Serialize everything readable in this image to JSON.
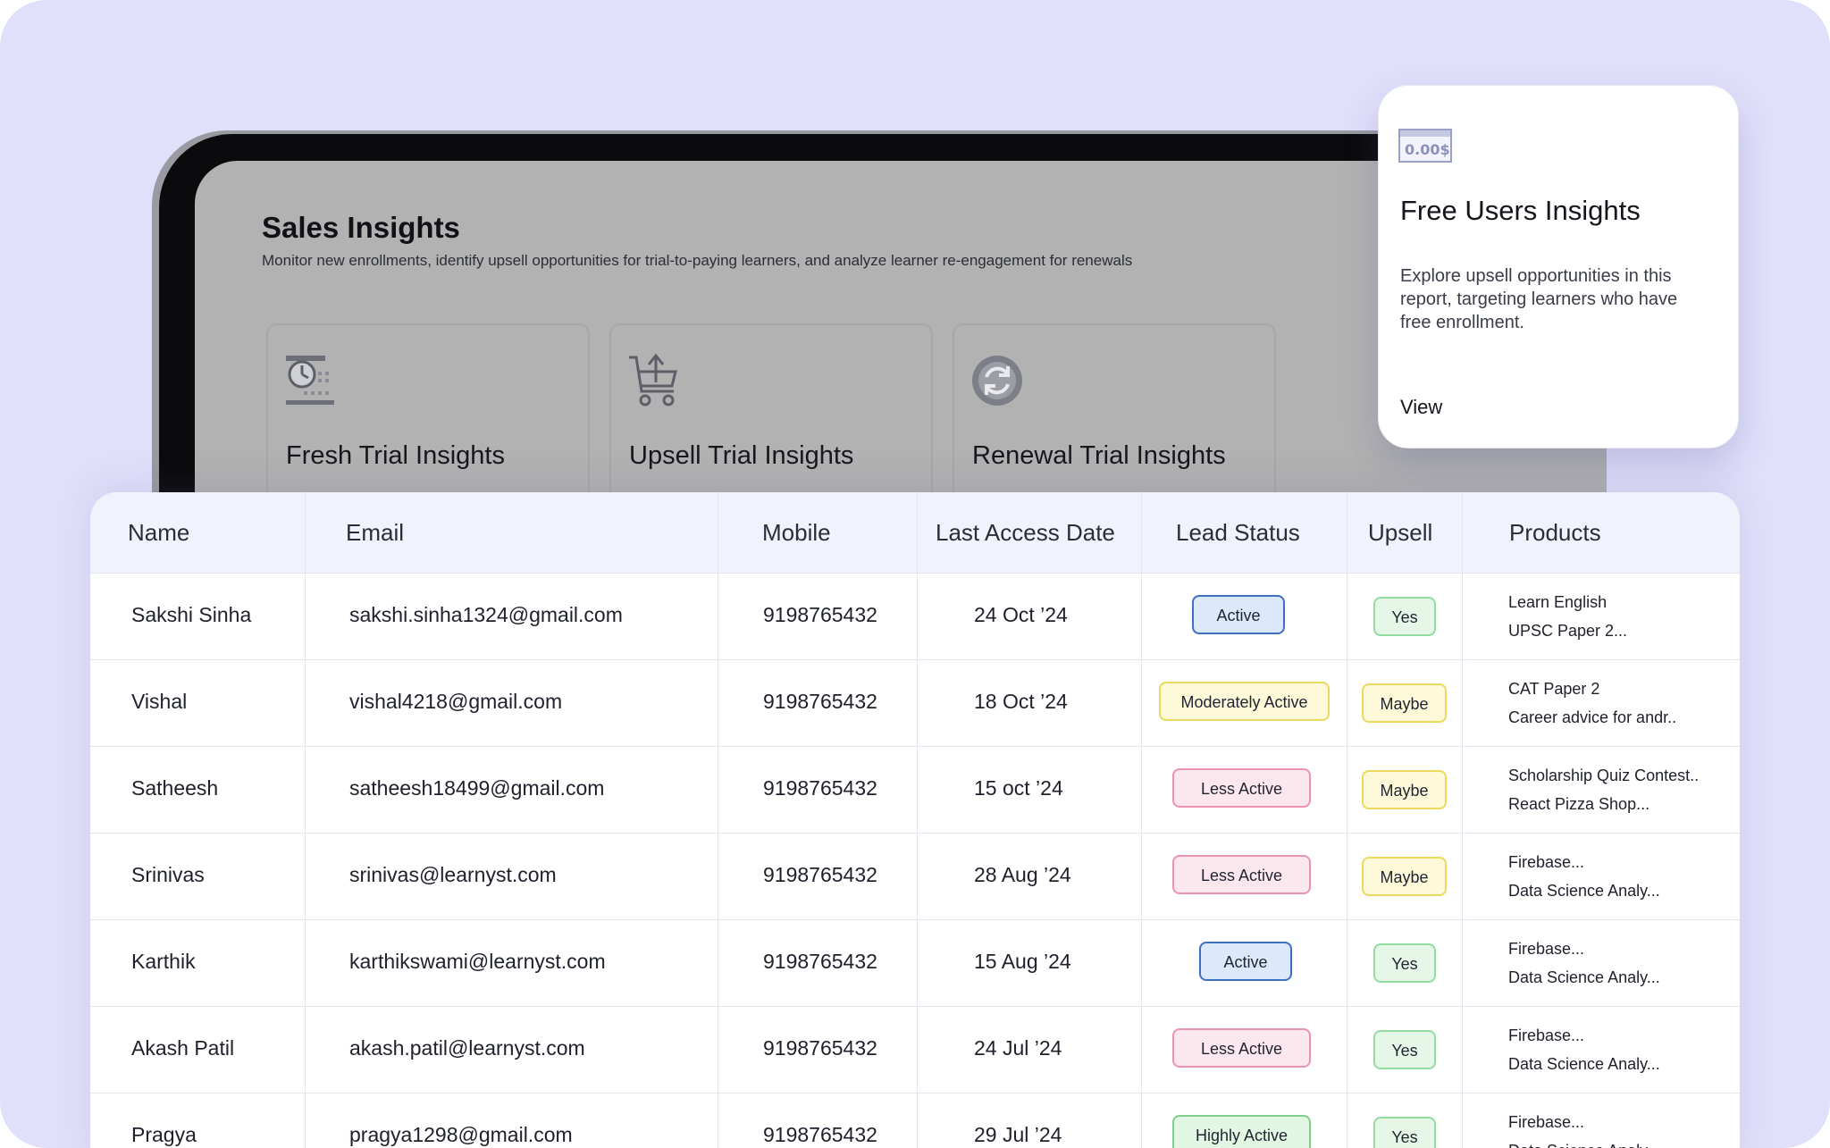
{
  "tablet": {
    "title": "Sales Insights",
    "subtitle": "Monitor new enrollments, identify upsell opportunities for trial-to-paying learners, and analyze learner re-engagement for renewals",
    "cards": [
      {
        "label": "Fresh Trial Insights",
        "icon": "clock-icon"
      },
      {
        "label": "Upsell Trial Insights",
        "icon": "cart-upload-icon"
      },
      {
        "label": "Renewal Trial Insights",
        "icon": "refresh-icon"
      }
    ]
  },
  "free_card": {
    "icon_amount": "0.00$",
    "title": "Free Users Insights",
    "description": "Explore upsell opportunities in this report, targeting learners who have free enrollment.",
    "view_label": "View"
  },
  "table": {
    "headers": [
      "Name",
      "Email",
      "Mobile",
      "Last Access Date",
      "Lead Status",
      "Upsell",
      "Products"
    ],
    "rows": [
      {
        "name": "Sakshi Sinha",
        "email": "sakshi.sinha1324@gmail.com",
        "mobile": "9198765432",
        "date": "24 Oct ’24",
        "status": "Active",
        "upsell": "Yes",
        "products": [
          "Learn English",
          "UPSC Paper 2..."
        ]
      },
      {
        "name": "Vishal",
        "email": "vishal4218@gmail.com",
        "mobile": "9198765432",
        "date": "18 Oct ’24",
        "status": "Moderately Active",
        "upsell": "Maybe",
        "products": [
          "CAT Paper 2",
          "Career advice for andr.."
        ]
      },
      {
        "name": "Satheesh",
        "email": "satheesh18499@gmail.com",
        "mobile": "9198765432",
        "date": "15 oct ’24",
        "status": "Less Active",
        "upsell": "Maybe",
        "products": [
          "Scholarship Quiz Contest..",
          "React Pizza Shop..."
        ]
      },
      {
        "name": "Srinivas",
        "email": "srinivas@learnyst.com",
        "mobile": "9198765432",
        "date": "28 Aug ’24",
        "status": "Less Active",
        "upsell": "Maybe",
        "products": [
          "Firebase...",
          "Data Science Analy..."
        ]
      },
      {
        "name": "Karthik",
        "email": "karthikswami@learnyst.com",
        "mobile": "9198765432",
        "date": "15 Aug ’24",
        "status": "Active",
        "upsell": "Yes",
        "products": [
          "Firebase...",
          "Data Science Analy..."
        ]
      },
      {
        "name": "Akash Patil",
        "email": "akash.patil@learnyst.com",
        "mobile": "9198765432",
        "date": "24 Jul ’24",
        "status": "Less Active",
        "upsell": "Yes",
        "products": [
          "Firebase...",
          "Data Science Analy..."
        ]
      },
      {
        "name": "Pragya",
        "email": "pragya1298@gmail.com",
        "mobile": "9198765432",
        "date": "29 Jul ’24",
        "status": "Highly Active",
        "upsell": "Yes",
        "products": [
          "Firebase...",
          "Data Science Analy..."
        ]
      }
    ]
  },
  "colors": {
    "background": "#e1e0fb",
    "active": {
      "bg": "#dbe9fb",
      "border": "#3f6fbd"
    },
    "moderately_active": {
      "bg": "#fdf9d9",
      "border": "#ead95d"
    },
    "less_active": {
      "bg": "#fde7ee",
      "border": "#ec93ae"
    },
    "highly_active": {
      "bg": "#e2f7e3",
      "border": "#7fd08a"
    },
    "yes": {
      "bg": "#e6f7e8",
      "border": "#93dca0"
    },
    "maybe": {
      "bg": "#fdf9d9",
      "border": "#ead95d"
    }
  }
}
